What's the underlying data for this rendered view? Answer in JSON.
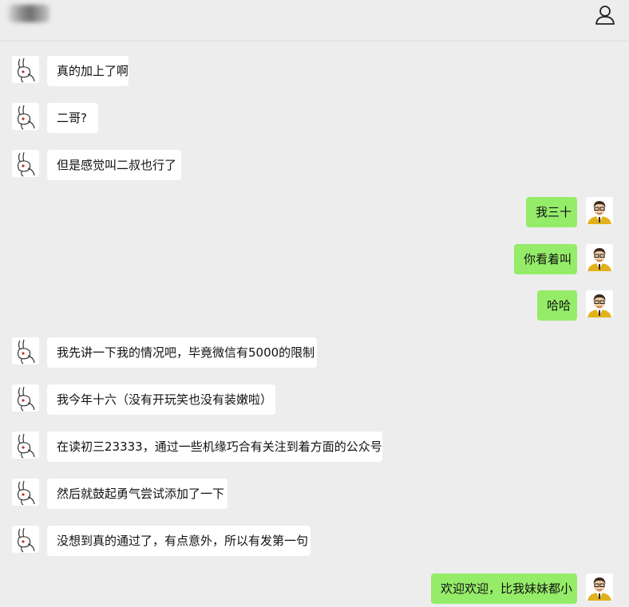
{
  "header": {
    "title": "",
    "title_blurred": true,
    "profile_icon": "person-outline-icon"
  },
  "colors": {
    "background": "#ededed",
    "incoming_bubble": "#ffffff",
    "outgoing_bubble": "#95ec69",
    "text": "#111111"
  },
  "contact_avatar_icon": "rabbit-avatar-icon",
  "self_avatar_icon": "cartoon-man-avatar-icon",
  "messages": [
    {
      "side": "in",
      "text": "真的加上了啊"
    },
    {
      "side": "in",
      "text": "二哥?"
    },
    {
      "side": "in",
      "text": "但是感觉叫二叔也行了"
    },
    {
      "side": "out",
      "text": "我三十"
    },
    {
      "side": "out",
      "text": "你看着叫"
    },
    {
      "side": "out",
      "text": "哈哈"
    },
    {
      "side": "in",
      "text": "我先讲一下我的情况吧，毕竟微信有5000的限制"
    },
    {
      "side": "in",
      "text": "我今年十六（没有开玩笑也没有装嫩啦）"
    },
    {
      "side": "in",
      "text": "在读初三23333，通过一些机缘巧合有关注到着方面的公众号"
    },
    {
      "side": "in",
      "text": "然后就鼓起勇气尝试添加了一下"
    },
    {
      "side": "in",
      "text": "没想到真的通过了，有点意外，所以有发第一句"
    },
    {
      "side": "out",
      "text": "欢迎欢迎，比我妹妹都小"
    }
  ]
}
